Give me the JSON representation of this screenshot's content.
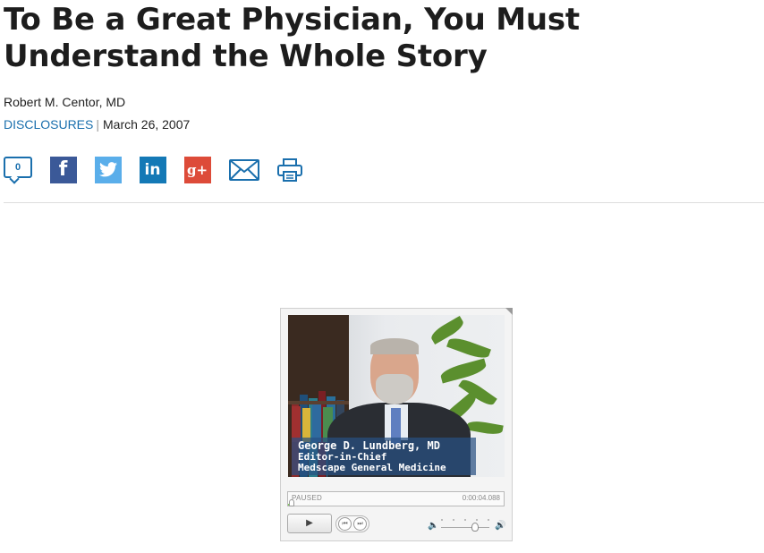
{
  "article": {
    "title": "To Be a Great Physician, You Must Understand the Whole Story",
    "author": "Robert M. Centor, MD",
    "disclosures_label": "DISCLOSURES",
    "separator": "|",
    "date": "March 26, 2007"
  },
  "share": {
    "comment_count": "0",
    "facebook_glyph": "f",
    "linkedin_glyph": "in",
    "googleplus_glyph": "g+",
    "icons": [
      "comment-icon",
      "facebook-icon",
      "twitter-icon",
      "linkedin-icon",
      "google-plus-icon",
      "email-icon",
      "print-icon"
    ],
    "colors": {
      "accent": "#1a6fad",
      "facebook": "#3b5998",
      "twitter": "#5aaeea",
      "linkedin": "#1479b6",
      "googleplus": "#dd4b39"
    }
  },
  "video": {
    "caption_name": "George D. Lundberg, MD",
    "caption_role": "Editor-in-Chief",
    "caption_org": "Medscape General Medicine",
    "status": "PAUSED",
    "time": "0:00:04.088",
    "progress_fraction": 0.02,
    "volume_fraction": 0.7,
    "play_glyph": "▶",
    "prev_glyph": "⏮",
    "next_glyph": "⏭",
    "volume_low_glyph": "🔈",
    "volume_high_glyph": "🔊",
    "progress_color": "#7fca5b"
  }
}
